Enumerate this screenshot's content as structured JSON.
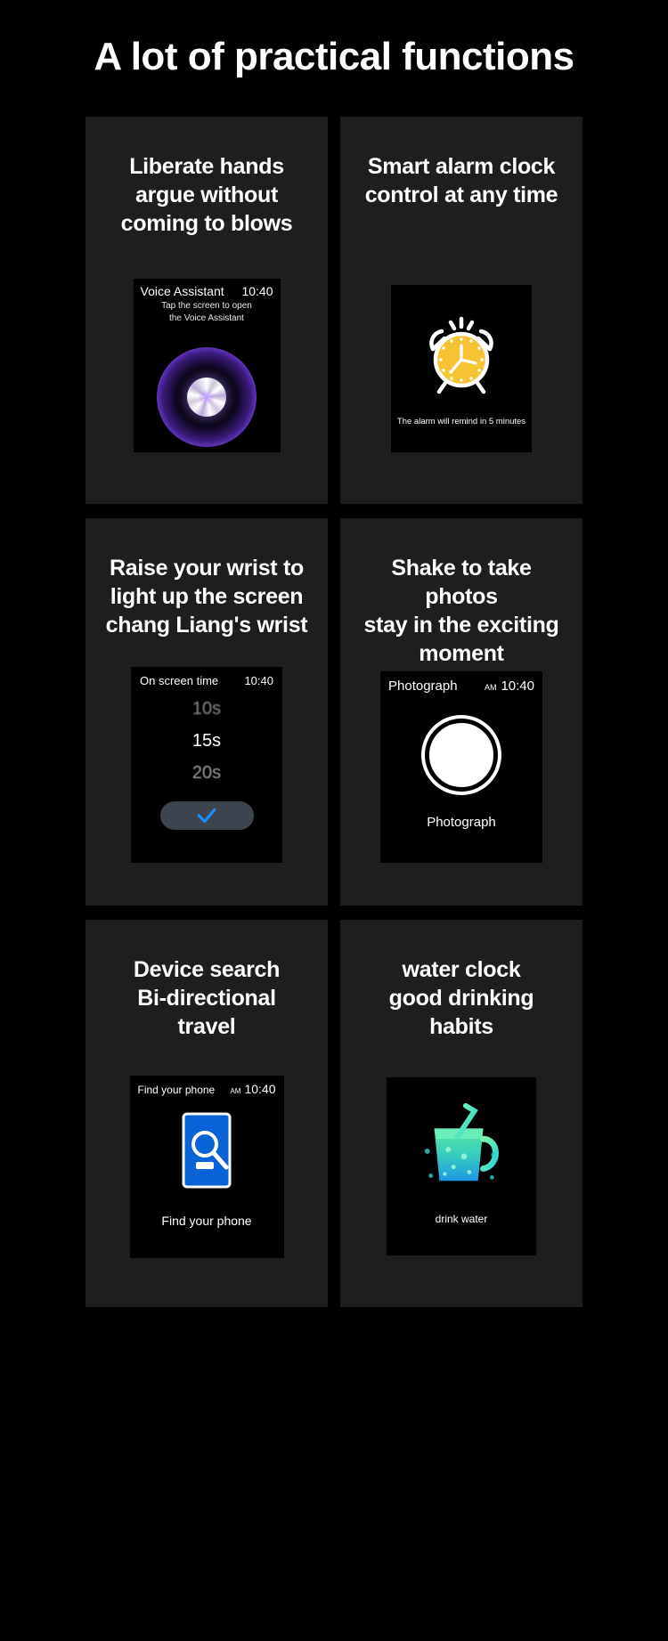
{
  "page": {
    "title": "A lot of practical functions",
    "background_color": "#000000",
    "card_color": "#1e1e1e",
    "accent_blue": "#1a8cff",
    "accent_yellow": "#f5c333"
  },
  "cards": [
    {
      "id": "voice-assistant",
      "title": "Liberate hands argue without coming to blows",
      "title_lines": [
        "Liberate hands",
        "argue without",
        "coming to blows"
      ],
      "screen": {
        "header_title": "Voice Assistant",
        "time": "10:40",
        "subtitle_lines": [
          "Tap the screen to open",
          "the Voice Assistant"
        ],
        "icon": "voice-orb-icon"
      }
    },
    {
      "id": "smart-alarm",
      "title": "Smart alarm clock control at any time",
      "title_lines": [
        "Smart alarm clock",
        "control at any time"
      ],
      "screen": {
        "caption": "The alarm will remind in 5 minutes",
        "icon": "alarm-clock-icon"
      }
    },
    {
      "id": "raise-wrist",
      "title": "Raise your wrist to light up the screen chang Liang's wrist",
      "title_lines": [
        "Raise your wrist to",
        "light up the screen",
        "chang Liang's wrist"
      ],
      "screen": {
        "header_title": "On screen time",
        "time": "10:40",
        "options": [
          "10s",
          "15s",
          "20s"
        ],
        "confirm_icon": "check-icon"
      }
    },
    {
      "id": "shake-photo",
      "title": "Shake to take photos stay in the exciting moment",
      "title_lines": [
        "Shake to take photos",
        "stay in the exciting",
        "moment"
      ],
      "screen": {
        "header_title": "Photograph",
        "ampm": "AM",
        "time": "10:40",
        "caption": "Photograph",
        "icon": "camera-shutter-icon"
      }
    },
    {
      "id": "device-search",
      "title": "Device search Bi-directional travel",
      "title_lines": [
        "Device search",
        "Bi-directional",
        "travel"
      ],
      "screen": {
        "header_title": "Find your phone",
        "ampm": "AM",
        "time": "10:40",
        "caption": "Find your phone",
        "icon": "phone-search-icon"
      }
    },
    {
      "id": "water-clock",
      "title": "water clock good drinking habits",
      "title_lines": [
        "water clock",
        "good drinking",
        "habits"
      ],
      "screen": {
        "caption": "drink water",
        "icon": "water-cup-icon"
      }
    }
  ]
}
